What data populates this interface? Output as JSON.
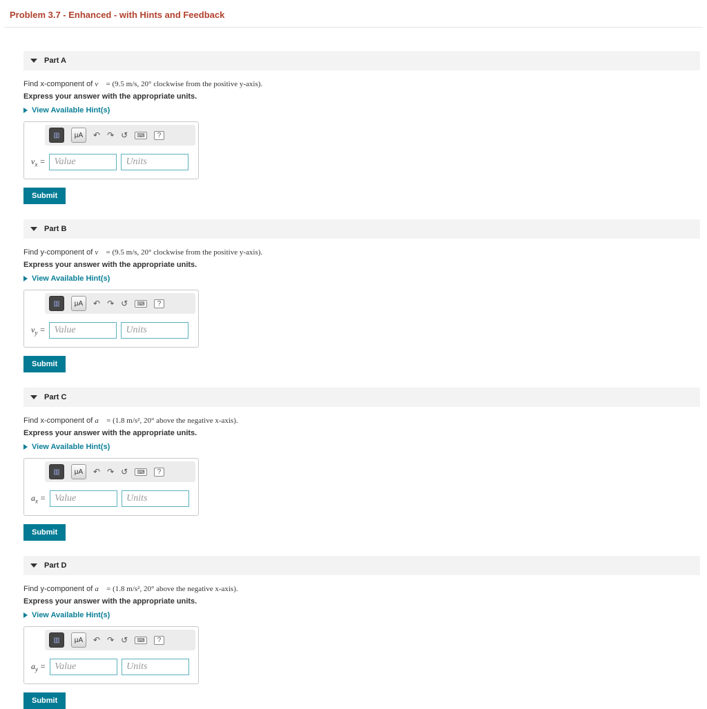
{
  "problem_title": "Problem 3.7 - Enhanced - with Hints and Feedback",
  "hints_label": "View Available Hint(s)",
  "express_units": "Express your answer with the appropriate units.",
  "value_placeholder": "Value",
  "units_placeholder": "Units",
  "submit_label": "Submit",
  "toolbar": {
    "mu_a_label": "μA",
    "help_label": "?"
  },
  "parts": [
    {
      "id": "A",
      "title": "Part A",
      "var_html": "v<sub>x</sub> =",
      "prompt_prefix": "Find x-component of ",
      "vector": "v⃗",
      "value_spec": "= (9.5 m/s, 20° clockwise from the positive y-axis)."
    },
    {
      "id": "B",
      "title": "Part B",
      "var_html": "v<sub>y</sub> =",
      "prompt_prefix": "Find y-component of ",
      "vector": "v⃗",
      "value_spec": "= (9.5 m/s, 20° clockwise from the positive y-axis)."
    },
    {
      "id": "C",
      "title": "Part C",
      "var_html": "a<sub>x</sub> =",
      "prompt_prefix": "Find x-component of ",
      "vector": "a⃗",
      "value_spec": "= (1.8 m/s², 20° above the negative x-axis)."
    },
    {
      "id": "D",
      "title": "Part D",
      "var_html": "a<sub>y</sub> =",
      "prompt_prefix": "Find y-component of ",
      "vector": "a⃗",
      "value_spec": "= (1.8 m/s², 20° above the negative x-axis)."
    }
  ]
}
